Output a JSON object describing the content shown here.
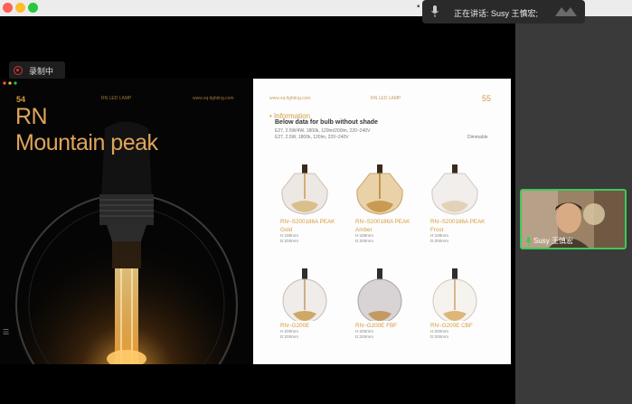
{
  "window": {
    "traffic_lights": [
      "close",
      "minimize",
      "zoom"
    ]
  },
  "recording": {
    "label": "录制中"
  },
  "speaking": {
    "text": "正在讲话: Susy 王慎宏;"
  },
  "participant": {
    "name": "Susy 王慎宏"
  },
  "slide_left": {
    "page": "54",
    "header_mid": "RN  LED LAMP",
    "header_url": "www.xq-lighting.com",
    "title_line1": "RN",
    "title_line2": "Mountain peak"
  },
  "slide_right": {
    "url": "www.xq-lighting.com",
    "header_mid": "RN  LED LAMP",
    "page": "55",
    "info_heading": "• Information",
    "info_sub": "Below data for bulb without shade",
    "spec1": "E27, 2.5W/4W, 1800k, 120lm/200lm, 220~240V",
    "spec2": "E27, 2.5W, 1800k, 120lm, 220~240V",
    "dimmable": "Dimmable",
    "products": [
      {
        "name1": "RN~S200186A PEAK",
        "name2": "Gold",
        "h": "H:188mm",
        "d": "D:200mm"
      },
      {
        "name1": "RN~S200186A PEAK",
        "name2": "Amber",
        "h": "H:188mm",
        "d": "D:200mm"
      },
      {
        "name1": "RN~S200186A PEAK",
        "name2": "Frost",
        "h": "H:188mm",
        "d": "D:200mm"
      },
      {
        "name1": "RN~G200E",
        "name2": "",
        "h": "H:200mm",
        "d": "D:200mm"
      },
      {
        "name1": "RN~G200E FBF",
        "name2": "",
        "h": "H:200mm",
        "d": "D:200mm"
      },
      {
        "name1": "RN~G200E CBF",
        "name2": "",
        "h": "H:200mm",
        "d": "D:200mm"
      }
    ]
  },
  "icons": {
    "record": "record-icon",
    "mic": "microphone-icon",
    "app_logo": "app-logo-icon",
    "menu": "menu-lines-icon"
  },
  "colors": {
    "accent_gold": "#d49a3f",
    "active_speaker": "#3ec95a",
    "record_red": "#dd3333"
  }
}
